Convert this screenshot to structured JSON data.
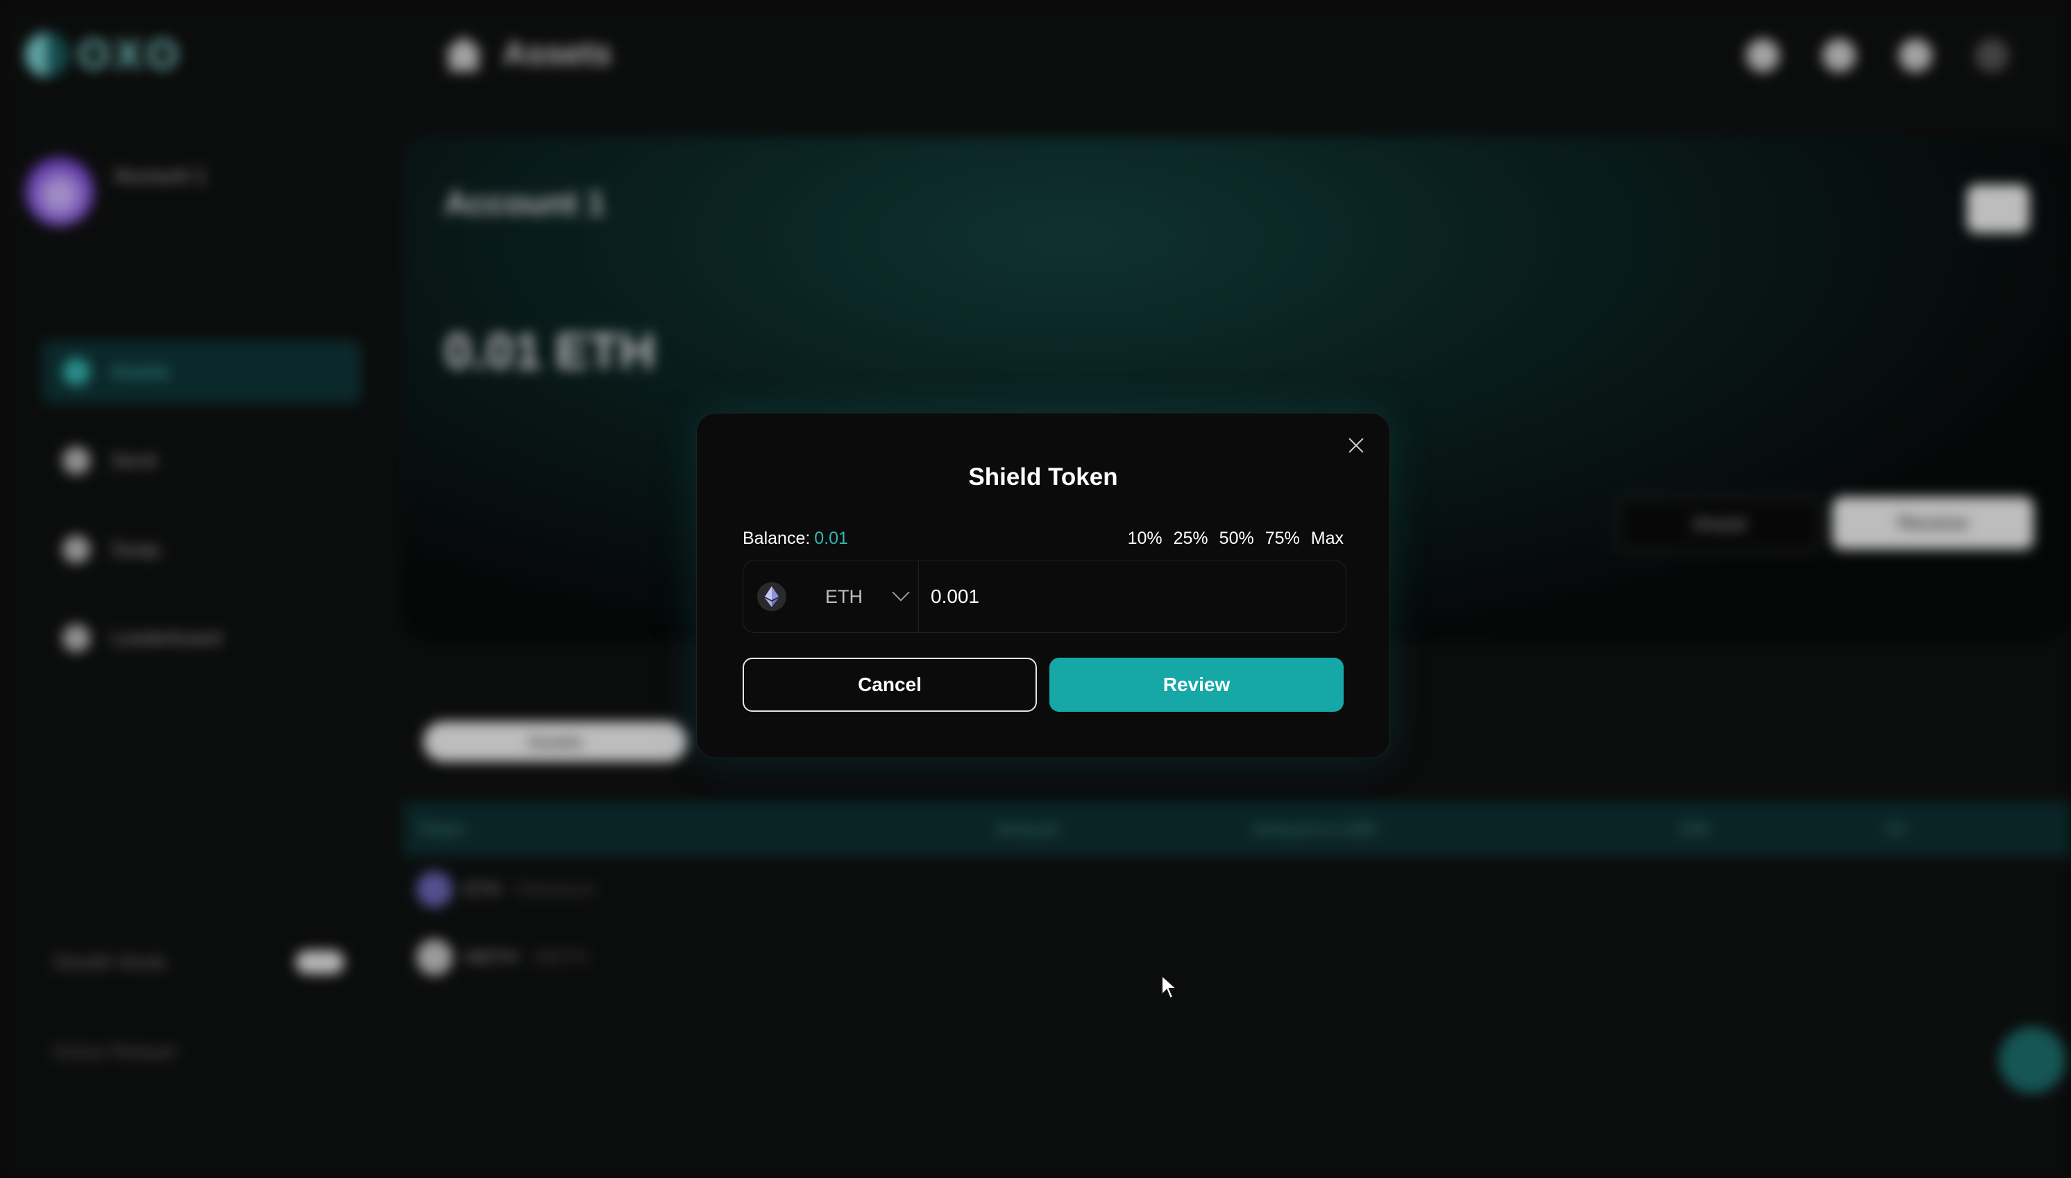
{
  "colors": {
    "accent": "#15a8a6",
    "balance_value": "#35b7b3",
    "modal_bg": "#0b0b0b",
    "page_bg": "#0f1010"
  },
  "background_app": {
    "logo_text": "OXO",
    "page_title": "Assets",
    "account_name": "Account 1",
    "card_title": "Account 1",
    "total_balance": "0.01 ETH",
    "nav_items": [
      "Assets",
      "Send",
      "Swap",
      "Leaderboard"
    ],
    "card_buttons": {
      "shield": "Shield",
      "receive": "Receive"
    },
    "tab": "Assets",
    "stealth_mode_label": "Stealth Mode",
    "active_relayer_label": "Active Relayer",
    "table_headers": [
      "Token",
      "Amount",
      "Amount in USD",
      "24h",
      "7d"
    ],
    "table_rows": [
      {
        "token": "ETH",
        "token_sub": "Ethereum"
      },
      {
        "token": "WETH",
        "token_sub": "WETH"
      }
    ]
  },
  "modal": {
    "title": "Shield Token",
    "balance_label": "Balance:",
    "balance_value": "0.01",
    "percent_options": [
      "10%",
      "25%",
      "50%",
      "75%",
      "Max"
    ],
    "token": {
      "symbol": "ETH",
      "icon": "ethereum-icon"
    },
    "amount_value": "0.001",
    "cancel_label": "Cancel",
    "review_label": "Review",
    "close_icon": "close-icon"
  }
}
